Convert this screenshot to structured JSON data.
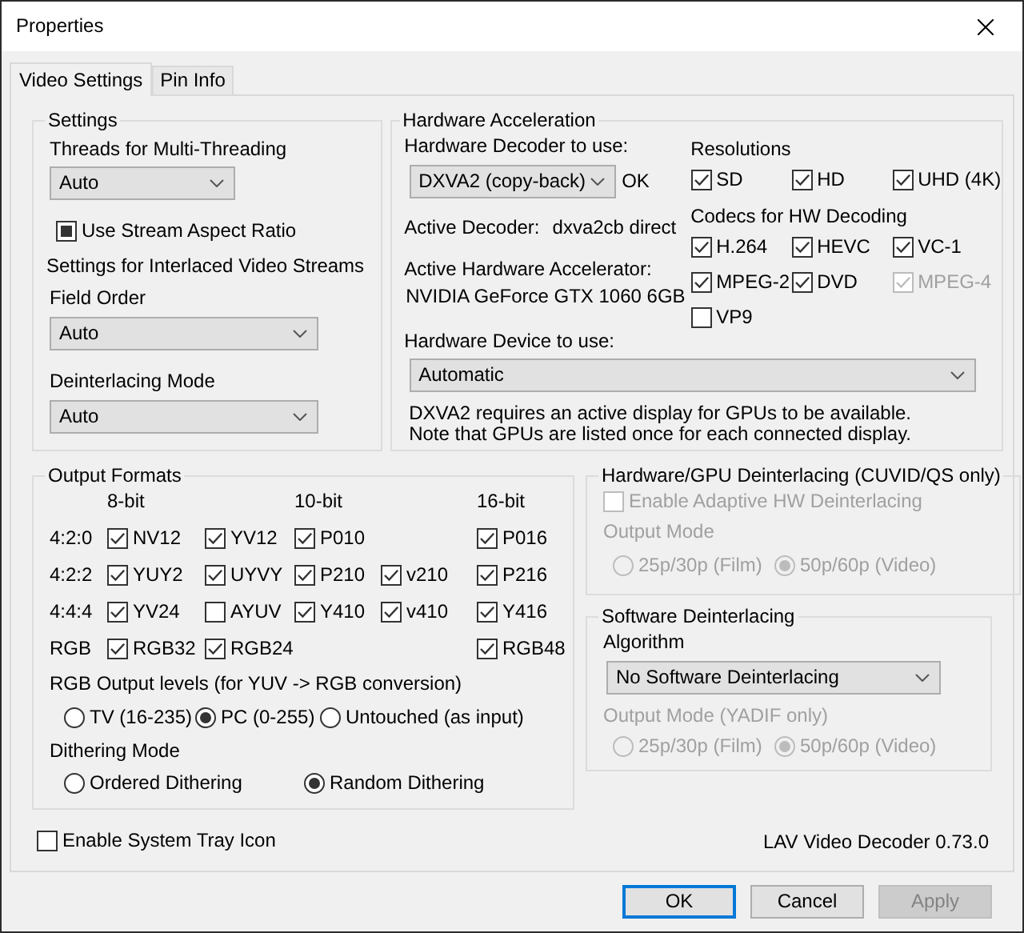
{
  "window": {
    "title": "Properties"
  },
  "tabs": [
    {
      "label": "Video Settings",
      "selected": true
    },
    {
      "label": "Pin Info",
      "selected": false
    }
  ],
  "settings": {
    "title": "Settings",
    "threads_label": "Threads for Multi-Threading",
    "threads_value": "Auto",
    "stream_aspect": {
      "label": "Use Stream Aspect Ratio",
      "indeterminate": true
    },
    "interlaced_title": "Settings for Interlaced Video Streams",
    "field_order_label": "Field Order",
    "field_order_value": "Auto",
    "deinterlacing_label": "Deinterlacing Mode",
    "deinterlacing_value": "Auto"
  },
  "hardware": {
    "title": "Hardware Acceleration",
    "decoder_label": "Hardware Decoder to use:",
    "decoder_value": "DXVA2 (copy-back)",
    "decoder_status": "OK",
    "active_decoder_label": "Active Decoder:",
    "active_decoder_value": "dxva2cb direct",
    "accelerator_label": "Active Hardware Accelerator:",
    "accelerator_value": "NVIDIA GeForce GTX 1060 6GB",
    "resolutions_title": "Resolutions",
    "resolutions": [
      {
        "label": "SD",
        "checked": true,
        "disabled": false
      },
      {
        "label": "HD",
        "checked": true,
        "disabled": false
      },
      {
        "label": "UHD (4K)",
        "checked": true,
        "disabled": false
      }
    ],
    "codecs_title": "Codecs for HW Decoding",
    "codecs": [
      {
        "label": "H.264",
        "checked": true,
        "disabled": false
      },
      {
        "label": "HEVC",
        "checked": true,
        "disabled": false
      },
      {
        "label": "VC-1",
        "checked": true,
        "disabled": false
      },
      {
        "label": "MPEG-2",
        "checked": true,
        "disabled": false
      },
      {
        "label": "DVD",
        "checked": true,
        "disabled": false
      },
      {
        "label": "MPEG-4",
        "checked": true,
        "disabled": true
      },
      {
        "label": "VP9",
        "checked": false,
        "disabled": false
      }
    ],
    "device_label": "Hardware Device to use:",
    "device_value": "Automatic",
    "note": [
      "DXVA2 requires an active display for GPUs to be available.",
      "Note that GPUs are listed once for each connected display."
    ]
  },
  "output_formats": {
    "title": "Output Formats",
    "headers": [
      {
        "kind": "header",
        "label": "8-bit"
      },
      {
        "kind": "empty"
      },
      {
        "kind": "header",
        "label": "10-bit"
      },
      {
        "kind": "empty"
      },
      {
        "kind": "header",
        "label": "16-bit"
      }
    ],
    "rows": [
      {
        "label": "4:2:0",
        "formats": [
          {
            "kind": "checkbox",
            "label": "NV12",
            "checked": true
          },
          {
            "kind": "checkbox",
            "label": "YV12",
            "checked": true
          },
          {
            "kind": "checkbox",
            "label": "P010",
            "checked": true
          },
          {
            "kind": "empty"
          },
          {
            "kind": "checkbox",
            "label": "P016",
            "checked": true
          }
        ]
      },
      {
        "label": "4:2:2",
        "formats": [
          {
            "kind": "checkbox",
            "label": "YUY2",
            "checked": true
          },
          {
            "kind": "checkbox",
            "label": "UYVY",
            "checked": true
          },
          {
            "kind": "checkbox",
            "label": "P210",
            "checked": true
          },
          {
            "kind": "checkbox",
            "label": "v210",
            "checked": true
          },
          {
            "kind": "checkbox",
            "label": "P216",
            "checked": true
          }
        ]
      },
      {
        "label": "4:4:4",
        "formats": [
          {
            "kind": "checkbox",
            "label": "YV24",
            "checked": true
          },
          {
            "kind": "checkbox",
            "label": "AYUV",
            "checked": false
          },
          {
            "kind": "checkbox",
            "label": "Y410",
            "checked": true
          },
          {
            "kind": "checkbox",
            "label": "v410",
            "checked": true
          },
          {
            "kind": "checkbox",
            "label": "Y416",
            "checked": true
          }
        ]
      },
      {
        "label": "RGB",
        "formats": [
          {
            "kind": "checkbox",
            "label": "RGB32",
            "checked": true
          },
          {
            "kind": "checkbox",
            "label": "RGB24",
            "checked": true
          },
          {
            "kind": "empty"
          },
          {
            "kind": "empty"
          },
          {
            "kind": "checkbox",
            "label": "RGB48",
            "checked": true
          }
        ]
      }
    ],
    "rgb_levels": {
      "title": "RGB Output levels (for YUV -> RGB conversion)",
      "options": [
        {
          "label": "TV (16-235)",
          "selected": false
        },
        {
          "label": "PC (0-255)",
          "selected": true
        },
        {
          "label": "Untouched (as input)",
          "selected": false
        }
      ]
    },
    "dithering": {
      "title": "Dithering Mode",
      "options": [
        {
          "label": "Ordered Dithering",
          "selected": false
        },
        {
          "label": "Random Dithering",
          "selected": true
        }
      ]
    }
  },
  "hw_deinterlacing": {
    "title": "Hardware/GPU Deinterlacing (CUVID/QS only)",
    "adaptive": {
      "label": "Enable Adaptive HW Deinterlacing",
      "checked": false,
      "disabled": true
    },
    "output_mode": {
      "label": "Output Mode",
      "disabled": true,
      "options": [
        {
          "label": "25p/30p (Film)",
          "selected": false
        },
        {
          "label": "50p/60p (Video)",
          "selected": true
        }
      ]
    }
  },
  "sw_deinterlacing": {
    "title": "Software Deinterlacing",
    "algorithm_label": "Algorithm",
    "algorithm_value": "No Software Deinterlacing",
    "output_mode": {
      "label": "Output Mode (YADIF only)",
      "disabled": true,
      "options": [
        {
          "label": "25p/30p (Film)",
          "selected": false
        },
        {
          "label": "50p/60p (Video)",
          "selected": true
        }
      ]
    }
  },
  "tray": {
    "label": "Enable System Tray Icon",
    "checked": false
  },
  "version": "LAV Video Decoder 0.73.0",
  "buttons": [
    {
      "label": "OK",
      "default": true,
      "disabled": false
    },
    {
      "label": "Cancel",
      "default": false,
      "disabled": false
    },
    {
      "label": "Apply",
      "default": false,
      "disabled": true
    }
  ]
}
